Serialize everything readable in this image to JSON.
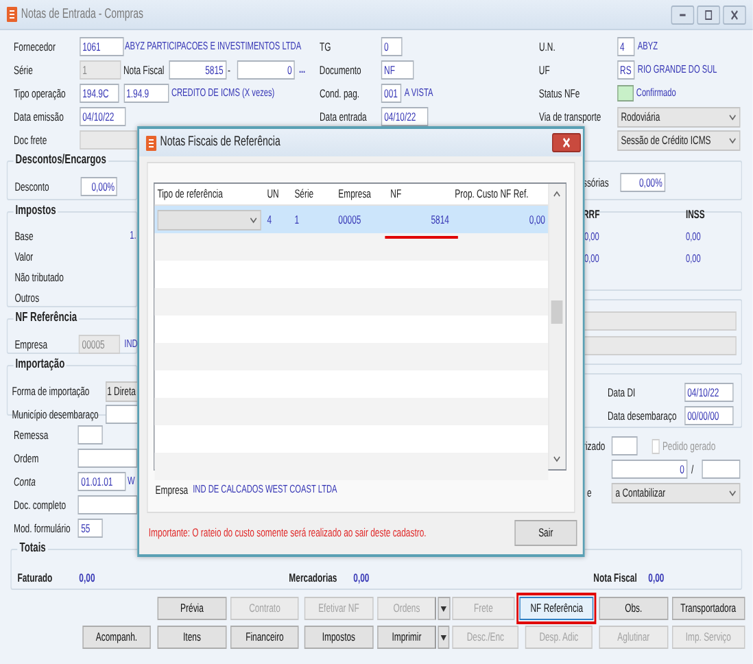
{
  "window": {
    "title": "Notas de Entrada - Compras"
  },
  "header_rows": [
    [
      {
        "kind": "label",
        "text": "Fornecedor"
      },
      {
        "kind": "field",
        "value": "1061",
        "disabled": false
      },
      {
        "kind": "text",
        "text": "ABYZ PARTICIPACOES E INVESTIMENTOS LTDA"
      },
      {
        "kind": "label",
        "text": "TG"
      },
      {
        "kind": "field",
        "value": "0",
        "disabled": false
      },
      {
        "kind": "label",
        "text": "U.N."
      },
      {
        "kind": "field",
        "value": "4",
        "disabled": false
      },
      {
        "kind": "text",
        "text": "ABYZ"
      }
    ],
    [
      {
        "kind": "label",
        "text": "Série"
      },
      {
        "kind": "field",
        "value": "1",
        "disabled": true
      },
      {
        "kind": "label",
        "text": "Nota Fiscal"
      },
      {
        "kind": "field",
        "value": "5815",
        "disabled": false
      },
      {
        "kind": "label",
        "text": "-"
      },
      {
        "kind": "field",
        "value": "0",
        "disabled": false
      },
      {
        "kind": "link",
        "text": "..."
      },
      {
        "kind": "label",
        "text": "Documento"
      },
      {
        "kind": "field",
        "value": "NF",
        "disabled": false
      },
      {
        "kind": "label",
        "text": "UF"
      },
      {
        "kind": "field",
        "value": "RS",
        "disabled": false
      },
      {
        "kind": "text",
        "text": "RIO GRANDE DO SUL"
      }
    ],
    [
      {
        "kind": "label",
        "text": "Tipo operação"
      },
      {
        "kind": "field",
        "value": "194.9C",
        "disabled": false
      },
      {
        "kind": "field",
        "value": "1.94.9",
        "disabled": false
      },
      {
        "kind": "text",
        "text": "CREDITO DE ICMS (X vezes)"
      },
      {
        "kind": "label",
        "text": "Cond. pag."
      },
      {
        "kind": "field",
        "value": "001",
        "disabled": false
      },
      {
        "kind": "text",
        "text": "A VISTA"
      },
      {
        "kind": "label",
        "text": "Status NFe"
      },
      {
        "kind": "status",
        "color": "#c8f0c8"
      },
      {
        "kind": "text",
        "text": "Confirmado"
      }
    ],
    [
      {
        "kind": "label",
        "text": "Data emissão"
      },
      {
        "kind": "field",
        "value": "04/10/22",
        "disabled": false
      },
      {
        "kind": "label",
        "text": "Data entrada"
      },
      {
        "kind": "field",
        "value": "04/10/22",
        "disabled": false
      },
      {
        "kind": "label",
        "text": "Via de transporte"
      },
      {
        "kind": "select",
        "value": "Rodoviária"
      }
    ],
    [
      {
        "kind": "label",
        "text": "Doc frete"
      },
      {
        "kind": "field",
        "disabled": true
      },
      {
        "kind": "select",
        "value": "Sessão de Crédito ICMS"
      }
    ]
  ],
  "descontos": {
    "title": "Descontos/Encargos",
    "label": "Desconto",
    "value": "0,00%"
  },
  "impostos": {
    "title": "Impostos",
    "rows": [
      {
        "label": "Base",
        "value": "1."
      },
      {
        "label": "Valor"
      },
      {
        "label": "Não tributado"
      },
      {
        "label": "Outros"
      }
    ]
  },
  "nf_referencia": {
    "title": "NF Referência",
    "label": "Empresa",
    "code": "00005",
    "name": "IND"
  },
  "importacao": {
    "title": "Importação",
    "rows": [
      {
        "kind": "select",
        "label": "Forma de importação",
        "value": "1 Direta"
      },
      {
        "kind": "field",
        "label": "Município desembaraço"
      }
    ]
  },
  "misc_rows": [
    {
      "label": "Remessa"
    },
    {
      "label": "Ordem"
    },
    {
      "label": "Conta",
      "value": "01.01.01",
      "name": "W"
    },
    {
      "label": "Doc. completo"
    },
    {
      "label": "Mod. formulário",
      "value": "55"
    }
  ],
  "right_panel": {
    "acessorias": {
      "label": "ssórias",
      "value": "0,00%"
    },
    "retencoes": {
      "columns": [
        "RRF",
        "INSS"
      ],
      "rows": [
        [
          "0,00",
          "0,00"
        ],
        [
          "0,00",
          "0,00"
        ]
      ]
    },
    "importacao_dates": [
      {
        "label": "Data DI",
        "value": "04/10/22"
      },
      {
        "label": "Data desembaraço",
        "value": "00/00/00"
      }
    ],
    "autorizado": {
      "label": "rizado"
    },
    "pedido_gerado": {
      "label": "Pedido gerado",
      "checked": false,
      "disabled": true
    },
    "numero": {
      "value": "0",
      "separator": "/"
    },
    "contabil": {
      "label": "e",
      "value": "a Contabilizar"
    }
  },
  "totais": {
    "title": "Totais",
    "items": [
      {
        "label": "Faturado",
        "value": "0,00"
      },
      {
        "label": "Mercadorias",
        "value": "0,00"
      },
      {
        "label": "Nota Fiscal",
        "value": "0,00"
      }
    ]
  },
  "button_rows": [
    [
      {
        "label": "Prévia",
        "disabled": false,
        "split": false,
        "highlighted": false
      },
      {
        "label": "Contrato",
        "disabled": true,
        "split": false,
        "highlighted": false
      },
      {
        "label": "Efetivar NF",
        "disabled": true,
        "split": false,
        "highlighted": false
      },
      {
        "label": "Ordens",
        "disabled": true,
        "split": true,
        "highlighted": false
      },
      {
        "label": "Frete",
        "disabled": true,
        "split": false,
        "highlighted": false
      },
      {
        "label": "NF Referência",
        "disabled": false,
        "split": false,
        "highlighted": true
      },
      {
        "label": "Obs.",
        "disabled": false,
        "split": false,
        "highlighted": false
      },
      {
        "label": "Transportadora",
        "disabled": false,
        "split": false,
        "highlighted": false
      }
    ],
    [
      {
        "label": "Acompanh.",
        "disabled": false,
        "split": false,
        "highlighted": false
      },
      {
        "label": "Itens",
        "disabled": false,
        "split": false,
        "highlighted": false
      },
      {
        "label": "Financeiro",
        "disabled": false,
        "split": false,
        "highlighted": false
      },
      {
        "label": "Impostos",
        "disabled": false,
        "split": false,
        "highlighted": false
      },
      {
        "label": "Imprimir",
        "disabled": false,
        "split": true,
        "highlighted": false
      },
      {
        "label": "Desc./Enc",
        "disabled": true,
        "split": false,
        "highlighted": false
      },
      {
        "label": "Desp. Adic",
        "disabled": true,
        "split": false,
        "highlighted": false
      },
      {
        "label": "Aglutinar",
        "disabled": true,
        "split": false,
        "highlighted": false
      },
      {
        "label": "Imp. Serviço",
        "disabled": true,
        "split": false,
        "highlighted": false
      }
    ]
  ],
  "dialog": {
    "title": "Notas Fiscais de Referência",
    "columns": [
      "Tipo de referência",
      "UN",
      "Série",
      "Empresa",
      "NF",
      "Prop. Custo NF Ref."
    ],
    "rows": [
      {
        "selected": true,
        "nf_underlined": true,
        "un": "4",
        "serie": "1",
        "empresa": "00005",
        "nf": "5814",
        "prop": "0,00"
      }
    ],
    "empresa_label": "Empresa",
    "empresa_name": "IND DE CALCADOS WEST COAST LTDA",
    "warning": "Importante: O rateio do custo somente será realizado ao sair deste cadastro.",
    "button": "Sair"
  }
}
